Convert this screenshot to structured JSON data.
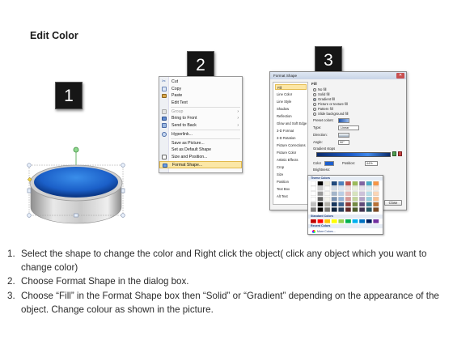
{
  "slide": {
    "title": "Edit Color"
  },
  "steps": [
    "1",
    "2",
    "3"
  ],
  "context_menu": {
    "items": [
      {
        "label": "Cut",
        "icon": "scissors-icon",
        "disabled": false,
        "submenu": false
      },
      {
        "label": "Copy",
        "icon": "copy-icon",
        "disabled": false,
        "submenu": false
      },
      {
        "label": "Paste",
        "icon": "paste-icon",
        "disabled": false,
        "submenu": false
      },
      {
        "label": "Edit Text",
        "icon": "",
        "disabled": false,
        "submenu": false
      },
      {
        "label": "Group",
        "icon": "group-icon",
        "disabled": true,
        "submenu": true
      },
      {
        "label": "Bring to Front",
        "icon": "bring-front-icon",
        "disabled": false,
        "submenu": true
      },
      {
        "label": "Send to Back",
        "icon": "send-back-icon",
        "disabled": false,
        "submenu": true
      },
      {
        "label": "Hyperlink...",
        "icon": "hyperlink-icon",
        "disabled": false,
        "submenu": false
      },
      {
        "label": "Save as Picture...",
        "icon": "",
        "disabled": false,
        "submenu": false
      },
      {
        "label": "Set as Default Shape",
        "icon": "",
        "disabled": false,
        "submenu": false
      },
      {
        "label": "Size and Position...",
        "icon": "size-position-icon",
        "disabled": false,
        "submenu": false
      },
      {
        "label": "Format Shape...",
        "icon": "format-shape-icon",
        "disabled": false,
        "submenu": false,
        "highlighted": true
      }
    ]
  },
  "format_dialog": {
    "title": "Format Shape",
    "close": "✕",
    "nav": [
      "Fill",
      "Line Color",
      "Line Style",
      "Shadow",
      "Reflection",
      "Glow and Soft Edges",
      "3-D Format",
      "3-D Rotation",
      "Picture Corrections",
      "Picture Color",
      "Artistic Effects",
      "Crop",
      "Size",
      "Position",
      "Text Box",
      "Alt Text"
    ],
    "selected_nav": "Fill",
    "heading": "Fill",
    "fill_options": [
      {
        "label": "No fill",
        "selected": false
      },
      {
        "label": "Solid fill",
        "selected": false
      },
      {
        "label": "Gradient fill",
        "selected": true
      },
      {
        "label": "Picture or texture fill",
        "selected": false
      },
      {
        "label": "Pattern fill",
        "selected": false
      },
      {
        "label": "Slide background fill",
        "selected": false
      }
    ],
    "fields": [
      {
        "label": "Preset colors:"
      },
      {
        "label": "Type:",
        "value": "Linear"
      },
      {
        "label": "Direction:"
      },
      {
        "label": "Angle:",
        "value": "90°"
      },
      {
        "label": "Gradient stops"
      }
    ],
    "color_label": "Color",
    "position_label": "Position:",
    "position_value": "44%",
    "brightness_label": "Brightness:",
    "transparency_label": "Transparency:",
    "rotate_label": "Rotate with shape",
    "close_button": "Close"
  },
  "palette": {
    "theme_label": "Theme Colors",
    "standard_label": "Standard Colors",
    "recent_label": "Recent Colors",
    "more_label": "More Colors..."
  },
  "instructions": [
    {
      "num": "1.",
      "text": "Select the shape to change the color and Right click the object( click any object which you want to change color)"
    },
    {
      "num": "2.",
      "text": "Choose Format Shape in the dialog box."
    },
    {
      "num": "3.",
      "text": "Choose “Fill” in the Format Shape box then “Solid” or “Gradient” depending on the appearance of the object. Change colour as shown in the picture."
    }
  ],
  "colors": {
    "shape_top": "#1e6fd6",
    "shape_side": "#b8b8b8",
    "menu_highlight": "#fbe7a6",
    "badge": "#161616"
  }
}
